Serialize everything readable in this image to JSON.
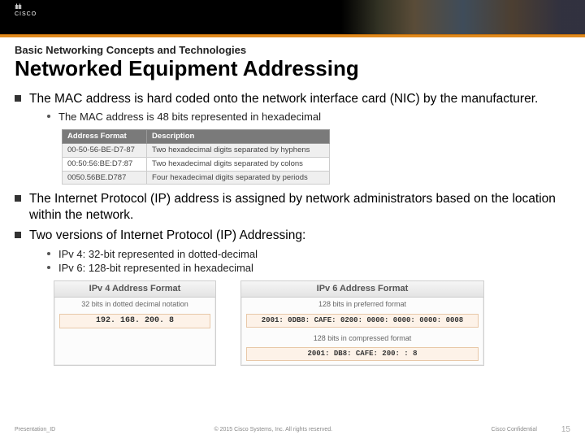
{
  "header": {
    "brand": "CISCO",
    "brand_bars": "ılıılı"
  },
  "slide": {
    "pretitle": "Basic Networking Concepts and Technologies",
    "title": "Networked Equipment Addressing"
  },
  "bullets": {
    "b1": "The MAC address is hard coded onto the network interface card (NIC) by the manufacturer.",
    "b1s1": "The MAC address is 48 bits represented in hexadecimal",
    "b2": "The Internet Protocol (IP) address is assigned by network administrators based on the location within the network.",
    "b3": "Two versions of Internet Protocol (IP) Addressing:",
    "b3s1": "IPv 4: 32-bit represented in dotted-decimal",
    "b3s2": "IPv 6: 128-bit represented in hexadecimal"
  },
  "mac_table": {
    "h1": "Address Format",
    "h2": "Description",
    "rows": [
      {
        "fmt": "00-50-56-BE-D7-87",
        "desc": "Two hexadecimal digits separated by hyphens"
      },
      {
        "fmt": "00:50:56:BE:D7:87",
        "desc": "Two hexadecimal digits separated by colons"
      },
      {
        "fmt": "0050.56BE.D787",
        "desc": "Four hexadecimal digits separated by periods"
      }
    ]
  },
  "ipv4": {
    "title": "IPv 4 Address Format",
    "sub": "32 bits in dotted decimal notation",
    "example": "192. 168. 200. 8"
  },
  "ipv6": {
    "title": "IPv 6 Address Format",
    "sub1": "128 bits in preferred format",
    "example1": "2001: 0DB8: CAFE: 0200: 0000: 0000: 0000: 0008",
    "sub2": "128 bits in compressed format",
    "example2": "2001: DB8: CAFE: 200: : 8"
  },
  "footer": {
    "left": "Presentation_ID",
    "center": "© 2015 Cisco Systems, Inc. All rights reserved.",
    "right": "Cisco Confidential",
    "page": "15"
  }
}
